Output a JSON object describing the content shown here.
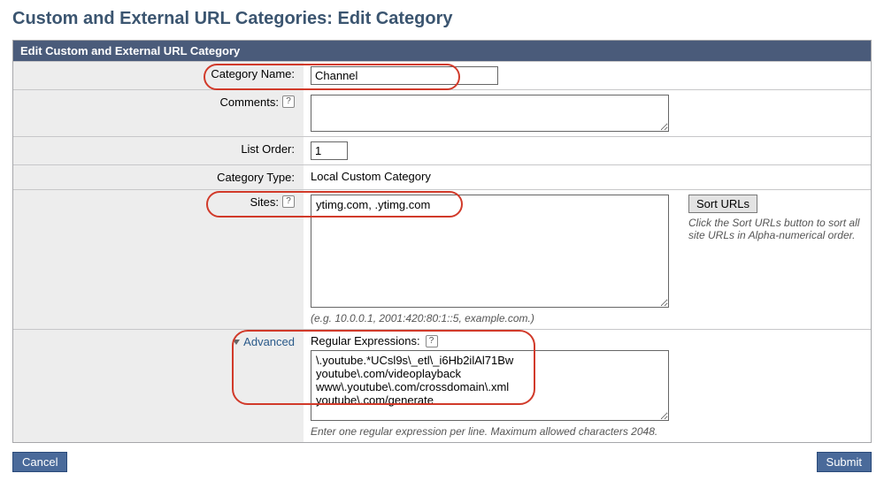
{
  "page": {
    "title": "Custom and External URL Categories: Edit Category",
    "panel_header": "Edit Custom and External URL Category"
  },
  "labels": {
    "category_name": "Category Name:",
    "comments": "Comments:",
    "list_order": "List Order:",
    "category_type": "Category Type:",
    "sites": "Sites:",
    "advanced_toggle": "Advanced",
    "regex_label": "Regular Expressions:"
  },
  "values": {
    "category_name": "Channel",
    "comments": "",
    "list_order": "1",
    "category_type": "Local Custom Category",
    "sites": "ytimg.com, .ytimg.com",
    "regex": "\\.youtube.*UCsl9s\\_etl\\_i6Hb2ilAl71Bw\nyoutube\\.com/videoplayback\nwww\\.youtube\\.com/crossdomain\\.xml\nyoutube\\.com/generate"
  },
  "hints": {
    "sites_example": "(e.g. 10.0.0.1, 2001:420:80:1::5, example.com.)",
    "sort_urls_help": "Click the Sort URLs button to sort all site URLs in Alpha-numerical order.",
    "regex_hint": "Enter one regular expression per line. Maximum allowed characters 2048."
  },
  "buttons": {
    "sort_urls": "Sort URLs",
    "cancel": "Cancel",
    "submit": "Submit"
  }
}
